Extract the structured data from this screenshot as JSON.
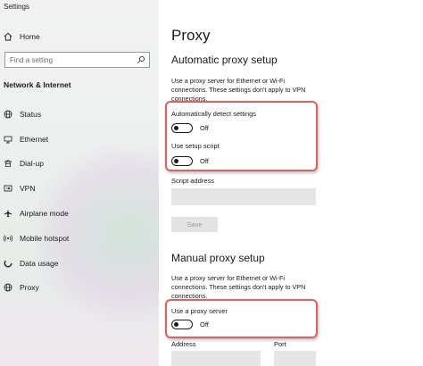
{
  "app": {
    "title": "Settings"
  },
  "search": {
    "placeholder": "Find a setting"
  },
  "sidebar": {
    "home_label": "Home",
    "section_title": "Network & Internet",
    "items": [
      {
        "label": "Status",
        "icon": "globe-icon"
      },
      {
        "label": "Ethernet",
        "icon": "ethernet-icon"
      },
      {
        "label": "Dial-up",
        "icon": "dialup-icon"
      },
      {
        "label": "VPN",
        "icon": "vpn-icon"
      },
      {
        "label": "Airplane mode",
        "icon": "airplane-icon"
      },
      {
        "label": "Mobile hotspot",
        "icon": "hotspot-icon"
      },
      {
        "label": "Data usage",
        "icon": "data-usage-icon"
      },
      {
        "label": "Proxy",
        "icon": "globe-icon"
      }
    ]
  },
  "main": {
    "title": "Proxy",
    "auto": {
      "heading": "Automatic proxy setup",
      "description": "Use a proxy server for Ethernet or Wi-Fi connections. These settings don't apply to VPN connections.",
      "detect_label": "Automatically detect settings",
      "detect_state": "Off",
      "script_label": "Use setup script",
      "script_state": "Off",
      "address_label": "Script address",
      "save_label": "Save"
    },
    "manual": {
      "heading": "Manual proxy setup",
      "description": "Use a proxy server for Ethernet or Wi-Fi connections. These settings don't apply to VPN connections.",
      "proxy_label": "Use a proxy server",
      "proxy_state": "Off",
      "address_label": "Address",
      "port_label": "Port"
    }
  },
  "colors": {
    "highlight": "#e45f5f",
    "sidebar_bg": "#f2f2f2",
    "field_bg": "#e6e6e6"
  }
}
